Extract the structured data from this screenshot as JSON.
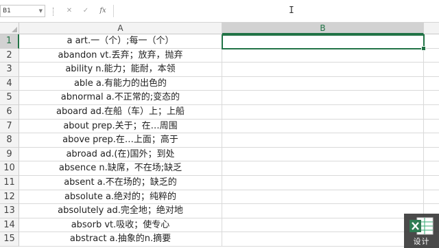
{
  "formula_bar": {
    "name_box": "B1",
    "cancel_icon": "✕",
    "enter_icon": "✓",
    "fx_label": "fx",
    "value": ""
  },
  "columns": [
    "A",
    "B"
  ],
  "selected_column": "B",
  "active_cell": "B1",
  "rows": [
    {
      "num": "1",
      "a": "a art.一（个）;每一（个）"
    },
    {
      "num": "2",
      "a": "abandon vt.丢弃；放弃，抛弃"
    },
    {
      "num": "3",
      "a": "ability n.能力；能耐，本领"
    },
    {
      "num": "4",
      "a": "able a.有能力的出色的"
    },
    {
      "num": "5",
      "a": "abnormal a.不正常的;变态的"
    },
    {
      "num": "6",
      "a": "aboard ad.在船（车）上；上船"
    },
    {
      "num": "7",
      "a": "about prep.关于；在…周围"
    },
    {
      "num": "8",
      "a": "above prep.在…上面；高于"
    },
    {
      "num": "9",
      "a": "abroad ad.(在)国外；到处"
    },
    {
      "num": "10",
      "a": "absence n.缺席，不在场;缺乏"
    },
    {
      "num": "11",
      "a": "absent a.不在场的；缺乏的"
    },
    {
      "num": "12",
      "a": "absolute a.绝对的；纯粹的"
    },
    {
      "num": "13",
      "a": "absolutely ad.完全地；绝对地"
    },
    {
      "num": "14",
      "a": "absorb vt.吸收；使专心"
    },
    {
      "num": "15",
      "a": "abstract a.抽象的n.摘要"
    }
  ],
  "logo": {
    "text": "设计"
  }
}
